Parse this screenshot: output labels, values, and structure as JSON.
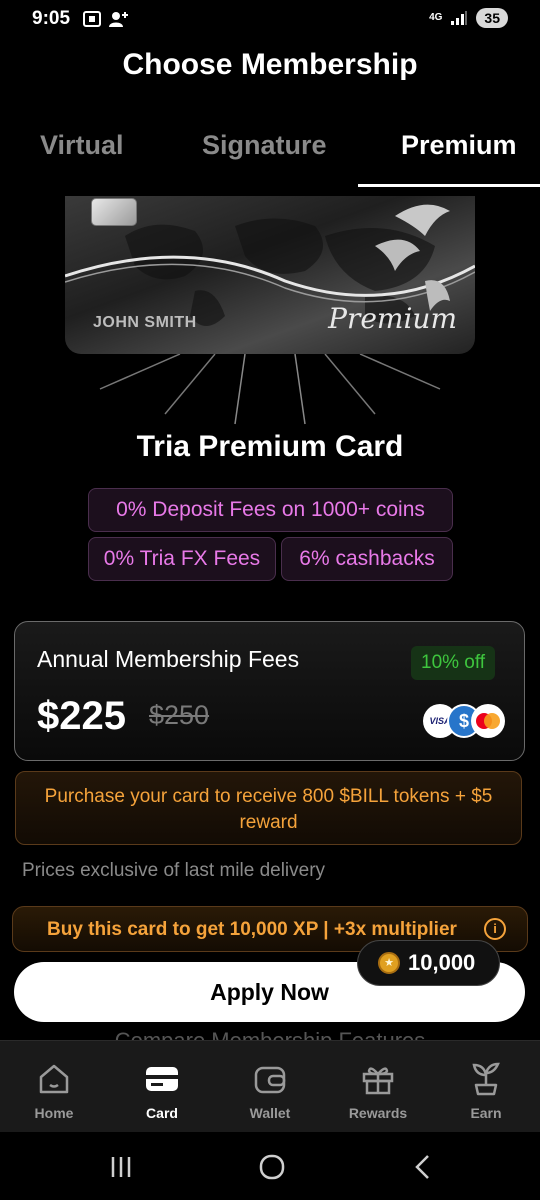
{
  "status_bar": {
    "time": "9:05",
    "network": "4G",
    "battery": "35"
  },
  "header": {
    "title": "Choose Membership"
  },
  "tabs": [
    {
      "label": "Virtual",
      "selected": false
    },
    {
      "label": "Signature",
      "selected": false
    },
    {
      "label": "Premium",
      "selected": true
    }
  ],
  "card": {
    "holder_name": "JOHN SMITH",
    "brand": "Premium",
    "title": "Tria Premium Card"
  },
  "features": [
    "0% Deposit Fees on 1000+ coins",
    "0% Tria FX Fees",
    "6% cashbacks"
  ],
  "fees": {
    "label": "Annual Membership Fees",
    "discount": "10% off",
    "price": "$225",
    "original_price": "$250",
    "payment_methods": [
      "visa-icon",
      "usdc-icon",
      "mastercard-icon"
    ]
  },
  "reward_banner": {
    "text": "Purchase your card to receive 800 $BILL tokens + $5 reward"
  },
  "delivery_note": "Prices exclusive of last mile delivery",
  "xp_banner": {
    "text": "Buy this card to get 10,000 XP | +3x multiplier"
  },
  "apply_button": {
    "label": "Apply Now"
  },
  "xp_pill": {
    "value": "10,000"
  },
  "compare_link": "Compare Membership Features",
  "bottom_nav": [
    {
      "label": "Home",
      "icon": "home-icon",
      "active": false
    },
    {
      "label": "Card",
      "icon": "card-icon",
      "active": true
    },
    {
      "label": "Wallet",
      "icon": "wallet-icon",
      "active": false
    },
    {
      "label": "Rewards",
      "icon": "gift-icon",
      "active": false
    },
    {
      "label": "Earn",
      "icon": "plant-icon",
      "active": false
    }
  ],
  "colors": {
    "accent_pink": "#e879e8",
    "accent_orange": "#f5a33b",
    "discount_green": "#3ec63e"
  }
}
